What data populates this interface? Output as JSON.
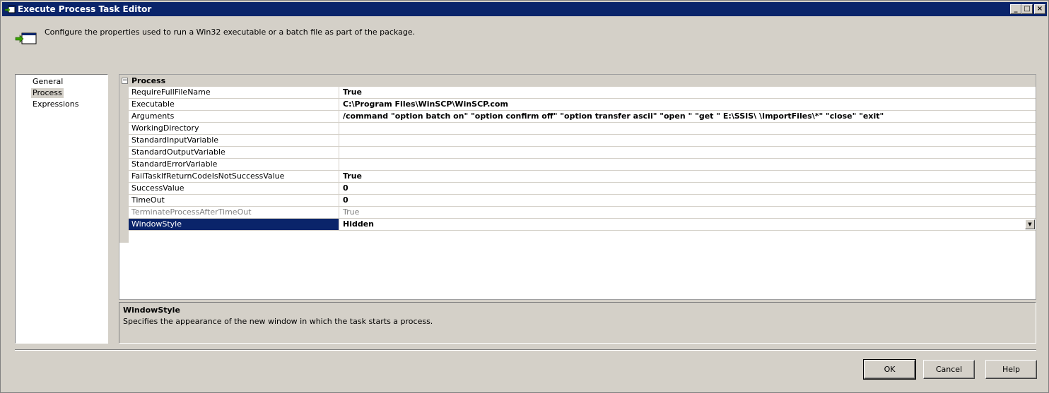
{
  "window": {
    "title": "Execute Process Task Editor",
    "controls": {
      "minimize": "_",
      "maximize": "□",
      "close": "×"
    }
  },
  "header": {
    "description": "Configure the properties used to run a Win32 executable or a batch file as part of the package."
  },
  "nav": {
    "items": [
      {
        "label": "General",
        "selected": false
      },
      {
        "label": "Process",
        "selected": true
      },
      {
        "label": "Expressions",
        "selected": false
      }
    ]
  },
  "grid": {
    "category": {
      "label": "Process",
      "toggle": "−"
    },
    "rows": [
      {
        "name": "RequireFullFileName",
        "value": "True"
      },
      {
        "name": "Executable",
        "value": "C:\\Program Files\\WinSCP\\WinSCP.com"
      },
      {
        "name": "Arguments",
        "value": "/command \"option batch on\" \"option confirm off\" \"option transfer ascii\" \"open \" \"get \" E:\\SSIS\\ \\ImportFiles\\*\" \"close\" \"exit\""
      },
      {
        "name": "WorkingDirectory",
        "value": ""
      },
      {
        "name": "StandardInputVariable",
        "value": ""
      },
      {
        "name": "StandardOutputVariable",
        "value": ""
      },
      {
        "name": "StandardErrorVariable",
        "value": ""
      },
      {
        "name": "FailTaskIfReturnCodeIsNotSuccessValue",
        "value": "True"
      },
      {
        "name": "SuccessValue",
        "value": "0"
      },
      {
        "name": "TimeOut",
        "value": "0"
      },
      {
        "name": "TerminateProcessAfterTimeOut",
        "value": "True",
        "disabled": true
      },
      {
        "name": "WindowStyle",
        "value": "Hidden",
        "selected": true,
        "dropdown": "▼"
      }
    ]
  },
  "help": {
    "title": "WindowStyle",
    "description": "Specifies the appearance of the new window in which the task starts a process."
  },
  "buttons": {
    "ok": "OK",
    "cancel": "Cancel",
    "help": "Help"
  },
  "colors": {
    "titlebar": "#0a246a",
    "face": "#d4d0c8",
    "selection": "#0a246a"
  }
}
